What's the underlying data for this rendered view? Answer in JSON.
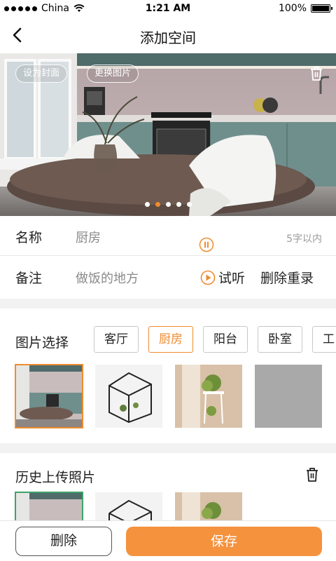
{
  "status_bar": {
    "carrier": "China",
    "time": "1:21 AM",
    "battery": "100%",
    "battery_level": 1.0
  },
  "nav": {
    "title": "添加空间"
  },
  "hero": {
    "set_cover_label": "设为封面",
    "change_image_label": "更换图片",
    "page_count": 5,
    "active_page": 1
  },
  "form": {
    "name_label": "名称",
    "name_value": "厨房",
    "name_hint": "5字以内",
    "note_label": "备注",
    "note_value": "做饭的地方",
    "listen_label": "试听",
    "rerecord_label": "删除重录"
  },
  "picker": {
    "label": "图片选择",
    "tags": [
      "客厅",
      "厨房",
      "阳台",
      "卧室",
      "工"
    ],
    "active_tag": "厨房"
  },
  "history": {
    "label": "历史上传照片"
  },
  "actions": {
    "delete_label": "删除",
    "save_label": "保存"
  },
  "colors": {
    "accent": "#f5923e",
    "accent_text": "#f08b2f",
    "history_selected": "#3fa46a"
  }
}
